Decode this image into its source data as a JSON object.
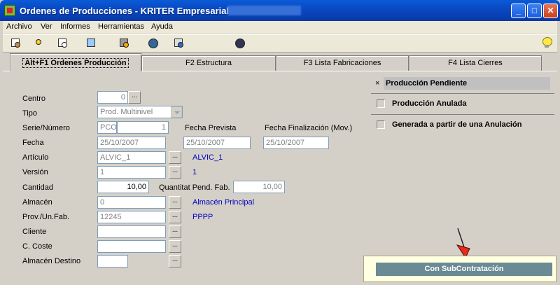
{
  "window": {
    "title": "Ordenes de Producciones - KRITER Empresarial",
    "controls": {
      "minimize": "_",
      "maximize": "□",
      "close": "✕"
    }
  },
  "menu": [
    "Archivo",
    "Ver",
    "Informes",
    "Herramientas",
    "Ayuda"
  ],
  "toolbar": {
    "icons": [
      "properties-icon",
      "clear-icon",
      "preview-icon",
      "search-icon",
      "process-icon",
      "globe-icon",
      "export-icon",
      "globe-key-icon"
    ],
    "help_icon": "lightbulb-icon"
  },
  "tabs": [
    {
      "label": "Alt+F1 Ordenes Producción",
      "active": true
    },
    {
      "label": "F2 Estructura",
      "active": false
    },
    {
      "label": "F3 Lista Fabricaciones",
      "active": false
    },
    {
      "label": "F4 Lista Cierres",
      "active": false
    }
  ],
  "form": {
    "centro": {
      "label": "Centro",
      "value": "0"
    },
    "tipo": {
      "label": "Tipo",
      "value": "Prod. Multinivel"
    },
    "serie_numero": {
      "label": "Serie/Número",
      "serie": "PCO",
      "numero": "1"
    },
    "fecha": {
      "label": "Fecha",
      "value": "25/10/2007"
    },
    "fecha_prevista": {
      "label": "Fecha Prevista",
      "value": "25/10/2007"
    },
    "fecha_finalizacion": {
      "label": "Fecha Finalización (Mov.)",
      "value": "25/10/2007"
    },
    "articulo": {
      "label": "Artículo",
      "value": "ALVIC_1",
      "desc": "ALVIC_1"
    },
    "version": {
      "label": "Versión",
      "value": "1",
      "desc": "1"
    },
    "cantidad": {
      "label": "Cantidad",
      "value": "10,00"
    },
    "quantitat": {
      "label": "Quantitat Pend. Fab.",
      "value": "10,00"
    },
    "almacen": {
      "label": "Almacén",
      "value": "0",
      "desc": "Almacén Principal"
    },
    "prov_unfab": {
      "label": "Prov./Un.Fab.",
      "value": "12245",
      "desc": "PPPP"
    },
    "cliente": {
      "label": "Cliente",
      "value": ""
    },
    "c_coste": {
      "label": "C. Coste",
      "value": ""
    },
    "almacen_destino": {
      "label": "Almacén Destino",
      "value": ""
    },
    "browse_label": "..."
  },
  "status": {
    "close_glyph": "×",
    "title": "Producción Pendiente",
    "rows": [
      "Producción Anulada",
      "Generada a partir de una Anulación"
    ]
  },
  "subcontratacion": {
    "label": "Con SubContratación"
  }
}
